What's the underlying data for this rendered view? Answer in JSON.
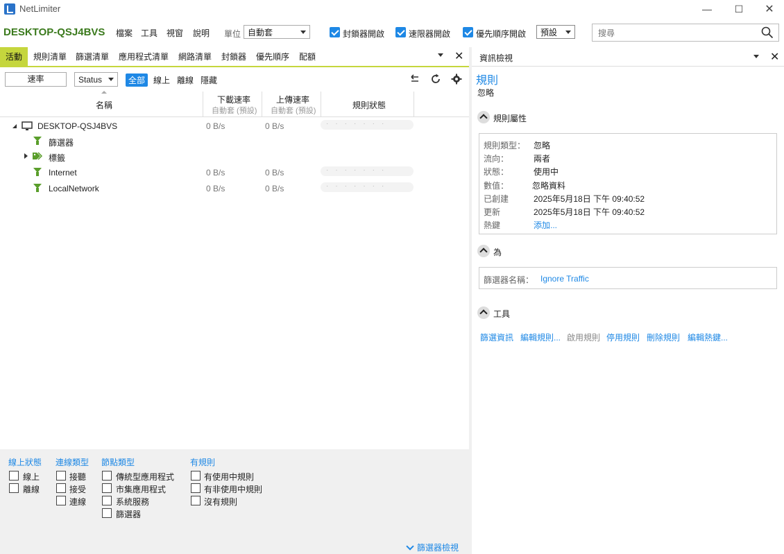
{
  "window": {
    "app_name": "NetLimiter"
  },
  "toolbar": {
    "machine_name": "DESKTOP-QSJ4BVS",
    "menu": [
      "檔案",
      "工具",
      "視窗",
      "說明"
    ],
    "unit_label": "單位",
    "unit_value": "自動套",
    "checks": [
      {
        "label": "封鎖器開啟",
        "checked": true
      },
      {
        "label": "速限器開啟",
        "checked": true
      },
      {
        "label": "優先順序開啟",
        "checked": true
      }
    ],
    "preset_value": "預設",
    "search_placeholder": "搜尋"
  },
  "left": {
    "tabs": [
      "活動",
      "規則清單",
      "篩選清單",
      "應用程式清單",
      "網路清單",
      "封鎖器",
      "優先順序",
      "配額"
    ],
    "active_tab": "活動",
    "rate_button": "速率",
    "status_select": "Status",
    "view_filters": [
      "全部",
      "線上",
      "離線",
      "隱藏"
    ],
    "columns": {
      "name": "名稱",
      "download": "下載速率",
      "download_sub": "自動套 (預設)",
      "upload": "上傳速率",
      "upload_sub": "自動套 (預設)",
      "rule_status": "規則狀態"
    },
    "rows": [
      {
        "name": "DESKTOP-QSJ4BVS",
        "down": "0 B/s",
        "up": "0 B/s"
      },
      {
        "name": "篩選器",
        "down": "",
        "up": ""
      },
      {
        "name": "標籤",
        "down": "",
        "up": ""
      },
      {
        "name": "Internet",
        "down": "0 B/s",
        "up": "0 B/s"
      },
      {
        "name": "LocalNetwork",
        "down": "0 B/s",
        "up": "0 B/s"
      }
    ]
  },
  "bottom": {
    "groups": [
      {
        "title": "線上狀態",
        "items": [
          "線上",
          "離線"
        ]
      },
      {
        "title": "連線類型",
        "items": [
          "接聽",
          "接受",
          "連線"
        ]
      },
      {
        "title": "節點類型",
        "items": [
          "傳統型應用程式",
          "市集應用程式",
          "系統服務",
          "篩選器"
        ]
      },
      {
        "title": "有規則",
        "items": [
          "有使用中規則",
          "有非使用中規則",
          "沒有規則"
        ]
      }
    ],
    "filter_view_link": "篩選器檢視"
  },
  "right": {
    "panel_title": "資訊檢視",
    "heading": "規則",
    "subheading": "忽略",
    "section_props": "規則屬性",
    "props": [
      {
        "label": "規則類型：",
        "value": "忽略"
      },
      {
        "label": "流向：",
        "value": "兩者"
      },
      {
        "label": "狀態：",
        "value": "使用中"
      },
      {
        "label": "數值：",
        "value": "忽略資料"
      },
      {
        "label": "已創建",
        "value": "2025年5月18日 下午 09:40:52"
      },
      {
        "label": "更新",
        "value": "2025年5月18日 下午 09:40:52"
      },
      {
        "label": "熱鍵",
        "value": "添加..."
      }
    ],
    "section_for": "為",
    "filter_name_label": "篩選器名稱：",
    "filter_name_value": "Ignore Traffic",
    "section_tools": "工具",
    "tools": [
      "篩選資訊",
      "編輯規則...",
      "啟用規則",
      "停用規則",
      "刪除規則",
      "編輯熱鍵..."
    ]
  }
}
